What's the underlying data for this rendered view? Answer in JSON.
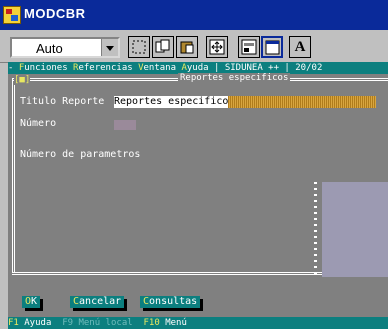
{
  "window": {
    "title": "MODCBR"
  },
  "toolbar": {
    "combo_value": "Auto",
    "bold_label": "A"
  },
  "menu": {
    "items": [
      {
        "hot": "F",
        "rest": "unciones"
      },
      {
        "hot": "R",
        "rest": "eferencias"
      },
      {
        "hot": "V",
        "rest": "entana"
      },
      {
        "hot": "A",
        "rest": "yuda"
      }
    ],
    "system": "SIDUNEA ++",
    "date": "20/02"
  },
  "panel": {
    "title": "Reportes especificos",
    "corner": "[■]",
    "fields": {
      "titulo_label": "Titulo Reporte",
      "titulo_value": "Reportes especificos",
      "numero_label": "Número",
      "parametros_label": "Número de parametros"
    }
  },
  "buttons": [
    {
      "hot": "O",
      "rest": "K"
    },
    {
      "hot": "C",
      "rest": "ancelar"
    },
    {
      "hot": "C",
      "rest": "onsultas"
    }
  ],
  "status": [
    {
      "key": "F1",
      "label": "Ayuda",
      "dim": false
    },
    {
      "key": "F9",
      "label": "Menú local",
      "dim": true
    },
    {
      "key": "F10",
      "label": "Menú",
      "dim": false
    }
  ]
}
